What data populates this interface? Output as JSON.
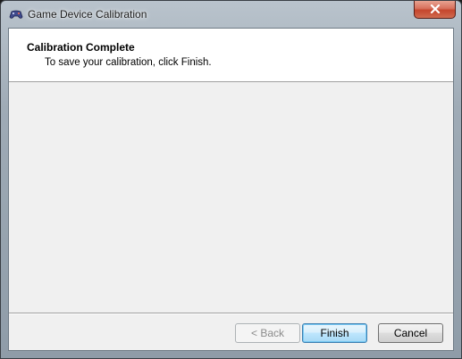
{
  "window": {
    "title": "Game Device Calibration",
    "app_icon": "gamepad-icon",
    "close_icon": "close-icon"
  },
  "header": {
    "title": "Calibration Complete",
    "subtitle": "To save your calibration, click Finish."
  },
  "buttons": {
    "back_label": "< Back",
    "finish_label": "Finish",
    "cancel_label": "Cancel"
  },
  "colors": {
    "close_button_red": "#c5452d",
    "dialog_background": "#f0f0f0",
    "header_background": "#ffffff",
    "default_button_highlight": "#3c7fb1"
  }
}
